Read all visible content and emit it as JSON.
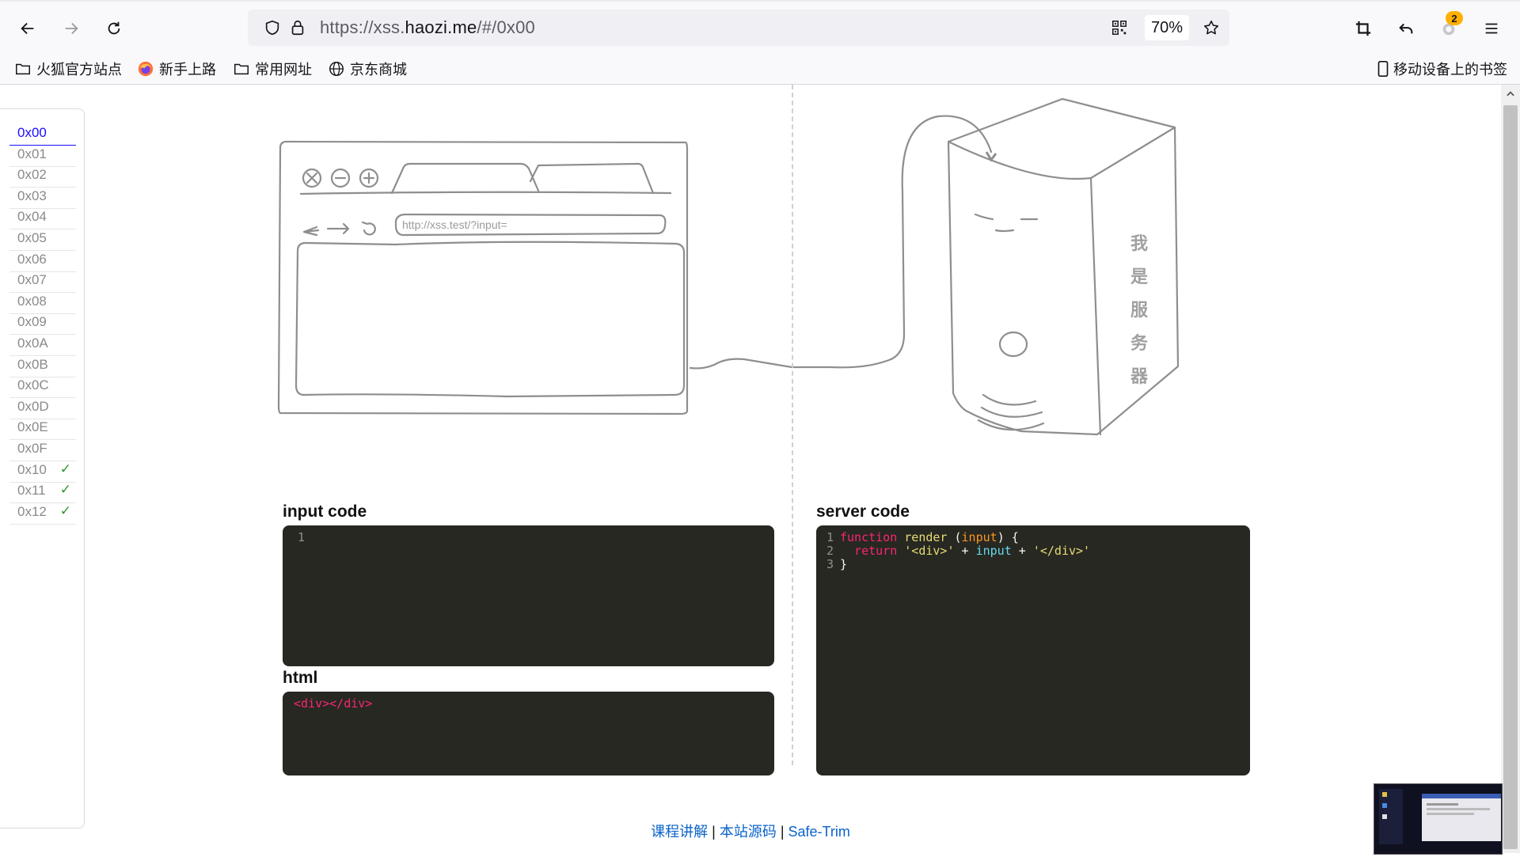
{
  "browser": {
    "url_prefix": "https://xss.",
    "url_domain": "haozi.me",
    "url_suffix": "/#/0x00",
    "zoom": "70%",
    "extensions_badge": "2"
  },
  "bookmarks": [
    {
      "label": "火狐官方站点",
      "icon": "folder-icon"
    },
    {
      "label": "新手上路",
      "icon": "firefox-icon"
    },
    {
      "label": "常用网址",
      "icon": "folder-icon"
    },
    {
      "label": "京东商城",
      "icon": "globe-icon"
    }
  ],
  "mobile_bookmarks": "移动设备上的书签",
  "levels": [
    {
      "label": "0x00",
      "active": true,
      "done": false
    },
    {
      "label": "0x01",
      "active": false,
      "done": false
    },
    {
      "label": "0x02",
      "active": false,
      "done": false
    },
    {
      "label": "0x03",
      "active": false,
      "done": false
    },
    {
      "label": "0x04",
      "active": false,
      "done": false
    },
    {
      "label": "0x05",
      "active": false,
      "done": false
    },
    {
      "label": "0x06",
      "active": false,
      "done": false
    },
    {
      "label": "0x07",
      "active": false,
      "done": false
    },
    {
      "label": "0x08",
      "active": false,
      "done": false
    },
    {
      "label": "0x09",
      "active": false,
      "done": false
    },
    {
      "label": "0x0A",
      "active": false,
      "done": false
    },
    {
      "label": "0x0B",
      "active": false,
      "done": false
    },
    {
      "label": "0x0C",
      "active": false,
      "done": false
    },
    {
      "label": "0x0D",
      "active": false,
      "done": false
    },
    {
      "label": "0x0E",
      "active": false,
      "done": false
    },
    {
      "label": "0x0F",
      "active": false,
      "done": false
    },
    {
      "label": "0x10",
      "active": false,
      "done": true
    },
    {
      "label": "0x11",
      "active": false,
      "done": true
    },
    {
      "label": "0x12",
      "active": false,
      "done": true
    }
  ],
  "check_mark": "✓",
  "sketch": {
    "address_bar": "http://xss.test/?input=",
    "server_chars": [
      "我",
      "是",
      "服",
      "务",
      "器"
    ]
  },
  "input_code": {
    "title": "input code",
    "line_number": "1",
    "value": ""
  },
  "html_output": {
    "title": "html",
    "value": "<div></div>"
  },
  "server_code": {
    "title": "server code",
    "lines": [
      {
        "n": "1",
        "tokens": [
          [
            "kw",
            "function"
          ],
          [
            "pl",
            " "
          ],
          [
            "fn",
            "render"
          ],
          [
            "pl",
            " ("
          ],
          [
            "pa",
            "input"
          ],
          [
            "pl",
            ") {"
          ]
        ]
      },
      {
        "n": "2",
        "tokens": [
          [
            "pl",
            "  "
          ],
          [
            "kw",
            "return"
          ],
          [
            "pl",
            " "
          ],
          [
            "st",
            "'<div>'"
          ],
          [
            "pl",
            " + "
          ],
          [
            "va",
            "input"
          ],
          [
            "pl",
            " + "
          ],
          [
            "st",
            "'</div>'"
          ]
        ]
      },
      {
        "n": "3",
        "tokens": [
          [
            "pl",
            "}"
          ]
        ]
      }
    ]
  },
  "footer": {
    "link1": "课程讲解",
    "sep": " | ",
    "link2": "本站源码",
    "link3": "Safe-Trim"
  },
  "colors": {
    "accent": "#1a0dff",
    "check": "#2b9a2b",
    "code_bg": "#272822",
    "link": "#0b63c9"
  }
}
